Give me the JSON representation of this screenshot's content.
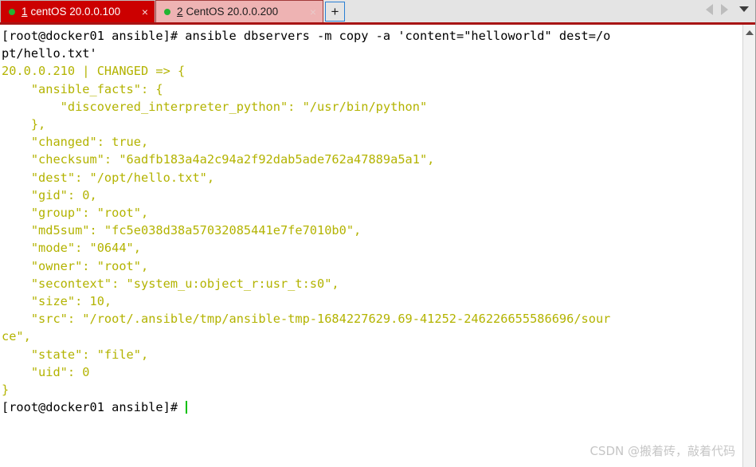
{
  "tabbar": {
    "tabs": [
      {
        "number": "1",
        "title": "centOS 20.0.0.100",
        "close_label": "×",
        "status_icon": "green-dot",
        "active": true
      },
      {
        "number": "2",
        "title": "CentOS 20.0.0.200",
        "close_label": "×",
        "status_icon": "green-dot",
        "active": false
      }
    ],
    "new_tab_label": "+",
    "nav_prev_icon": "triangle-left-icon",
    "nav_next_icon": "triangle-right-icon",
    "nav_menu_icon": "caret-down-icon",
    "active_tab_bg": "#cc0000",
    "inactive_tab_bg": "#eeb3b3",
    "accent_line": "#a81414"
  },
  "terminal": {
    "prompt": "[root@docker01 ansible]#",
    "command_line_1": "[root@docker01 ansible]# ansible dbservers -m copy -a 'content=\"helloworld\" dest=/o",
    "command_line_2": "pt/hello.txt'",
    "output_lines": [
      "20.0.0.210 | CHANGED => {",
      "    \"ansible_facts\": {",
      "        \"discovered_interpreter_python\": \"/usr/bin/python\"",
      "    },",
      "    \"changed\": true,",
      "    \"checksum\": \"6adfb183a4a2c94a2f92dab5ade762a47889a5a1\",",
      "    \"dest\": \"/opt/hello.txt\",",
      "    \"gid\": 0,",
      "    \"group\": \"root\",",
      "    \"md5sum\": \"fc5e038d38a57032085441e7fe7010b0\",",
      "    \"mode\": \"0644\",",
      "    \"owner\": \"root\",",
      "    \"secontext\": \"system_u:object_r:usr_t:s0\",",
      "    \"size\": 10,",
      "    \"src\": \"/root/.ansible/tmp/ansible-tmp-1684227629.69-41252-246226655586696/sour",
      "ce\",",
      "    \"state\": \"file\",",
      "    \"uid\": 0",
      "}"
    ],
    "final_prompt": "[root@docker01 ansible]# ",
    "cmd_color": "#000000",
    "output_color": "#b3b300",
    "cursor_color": "#00c000",
    "background": "#ffffff"
  },
  "scrollbar": {
    "up_arrow_icon": "caret-up-icon"
  },
  "watermark": {
    "text": "CSDN @搬着砖，敲着代码"
  }
}
